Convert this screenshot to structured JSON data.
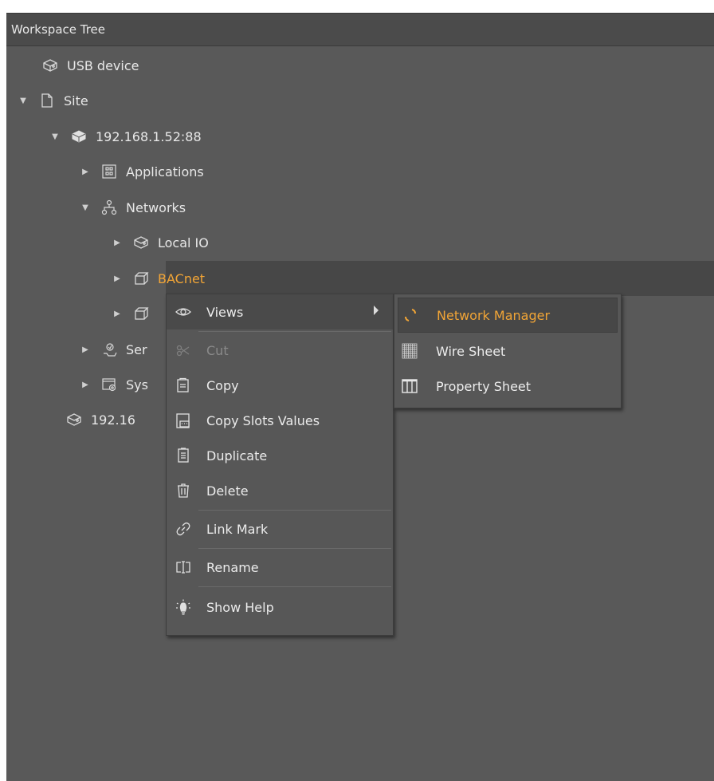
{
  "panel": {
    "title": "Workspace Tree"
  },
  "tree": {
    "usb_device": "USB device",
    "site": "Site",
    "host": "192.168.1.52:88",
    "applications": "Applications",
    "networks": "Networks",
    "local_io": "Local IO",
    "bacnet": "BACnet",
    "services_partial": "Ser",
    "system_partial": "Sys",
    "second_host_partial": "192.16"
  },
  "context_menu": {
    "items": [
      {
        "label": "Views",
        "icon": "eye-icon",
        "has_submenu": true
      },
      {
        "label": "Cut",
        "icon": "scissors-icon",
        "disabled": true
      },
      {
        "label": "Copy",
        "icon": "copy-icon"
      },
      {
        "label": "Copy Slots Values",
        "icon": "copy-values-icon"
      },
      {
        "label": "Duplicate",
        "icon": "duplicate-icon"
      },
      {
        "label": "Delete",
        "icon": "trash-icon"
      },
      {
        "label": "Link Mark",
        "icon": "link-icon"
      },
      {
        "label": "Rename",
        "icon": "rename-icon"
      },
      {
        "label": "Show Help",
        "icon": "lightbulb-icon"
      }
    ]
  },
  "submenu": {
    "items": [
      {
        "label": "Network Manager",
        "icon": "spinner-icon",
        "active": true
      },
      {
        "label": "Wire Sheet",
        "icon": "grid-icon"
      },
      {
        "label": "Property Sheet",
        "icon": "columns-icon"
      }
    ]
  },
  "colors": {
    "panel_bg": "#595959",
    "accent": "#f2a536",
    "text": "#e8e8e8",
    "disabled_text": "#8a8a8a"
  }
}
